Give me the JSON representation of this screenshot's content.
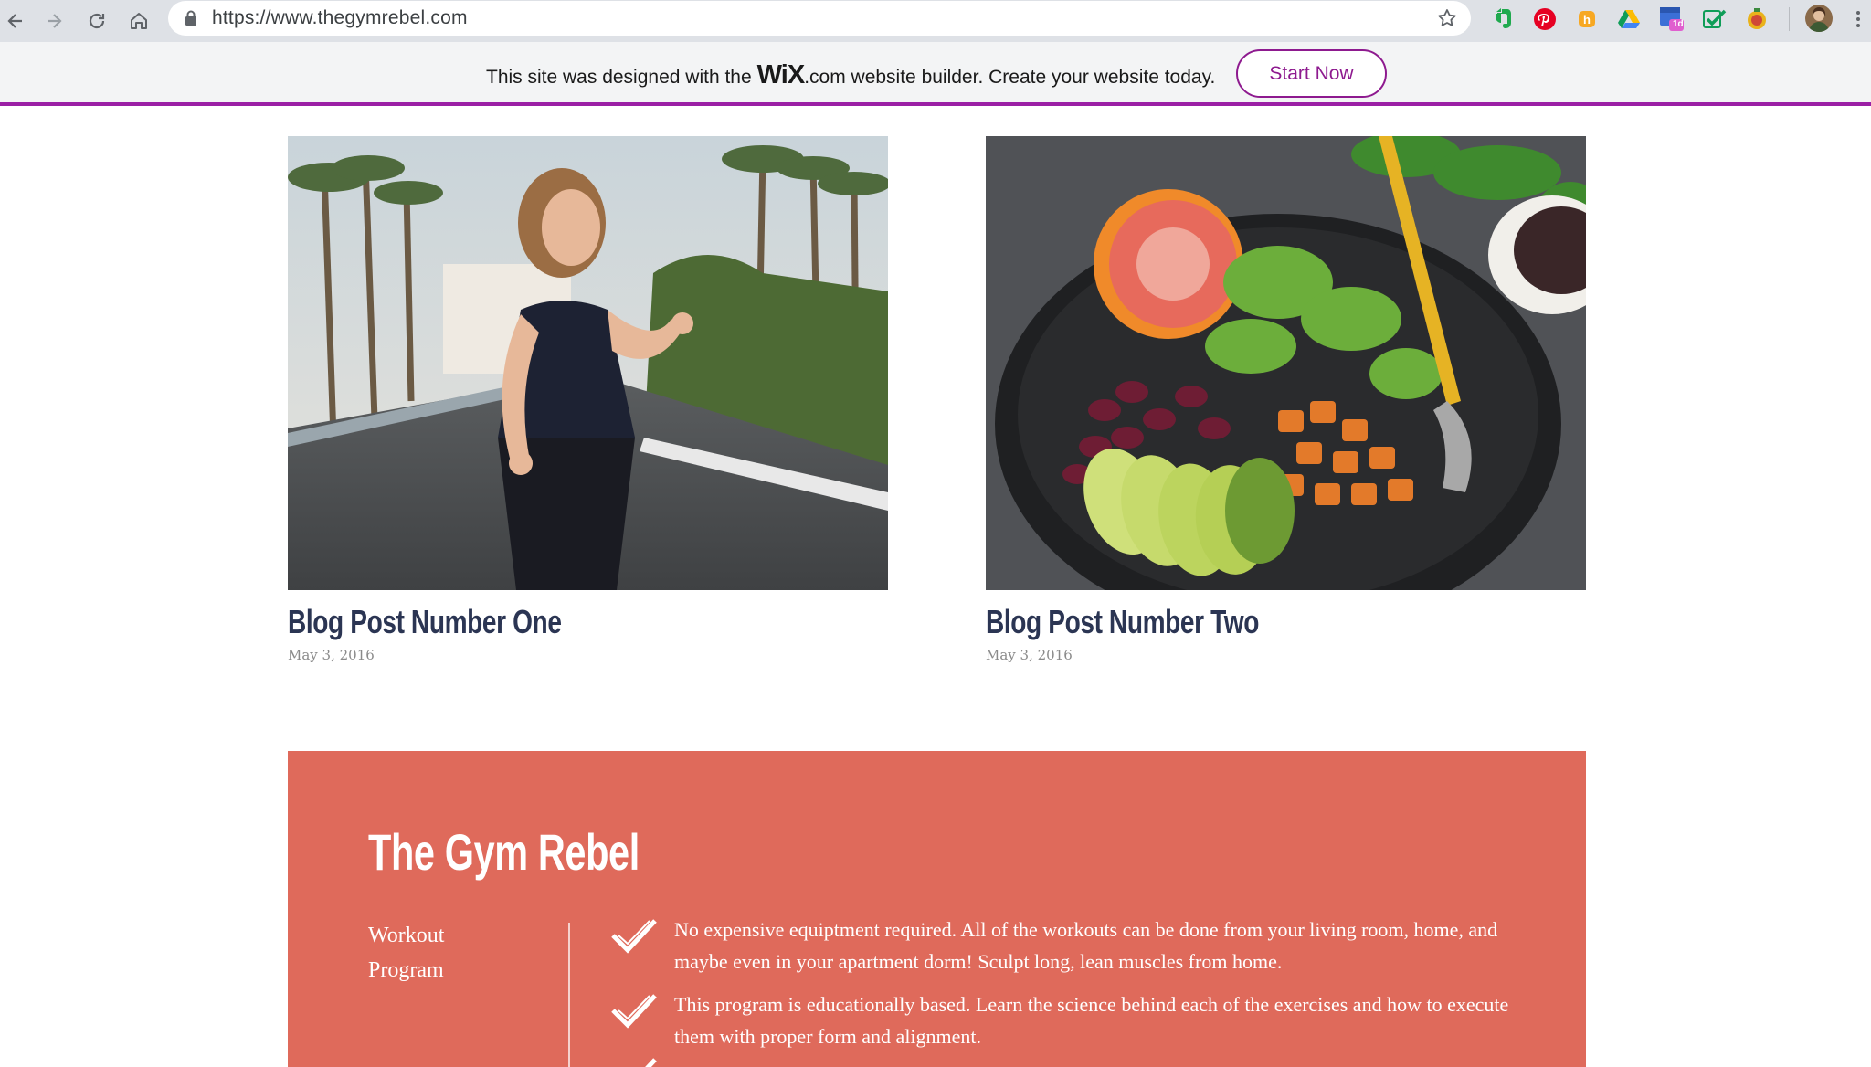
{
  "browser": {
    "url": "https://www.thegymrebel.com",
    "extension_badge": "1d"
  },
  "wix_banner": {
    "text_before": "This site was designed with the",
    "logo": "WiX",
    "text_after": ".com website builder. Create your website today.",
    "button_label": "Start Now",
    "accent_color": "#9b1fa5"
  },
  "posts": [
    {
      "title": "Blog Post Number One",
      "date": "May 3, 2016"
    },
    {
      "title": "Blog Post Number Two",
      "date": "May 3, 2016"
    }
  ],
  "promo": {
    "title": "The Gym Rebel",
    "label": "Workout Program",
    "background_color": "#df6a5b",
    "items": [
      "No expensive equiptment required. All of the workouts can be done from your living room, home, and maybe even in your apartment dorm! Sculpt long, lean muscles from home.",
      "This program is educationally based. Learn the science behind each of the exercises and how to execute them with proper form and alignment."
    ]
  }
}
